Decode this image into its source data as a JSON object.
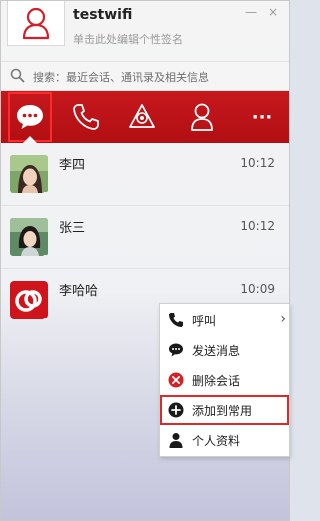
{
  "header": {
    "username": "testwifi",
    "signature": "单击此处编辑个性签名",
    "minimize_label": "—",
    "close_label": "×"
  },
  "search": {
    "placeholder": "搜索：最近会话、通讯录及相关信息"
  },
  "tabs": [
    {
      "icon": "chat-bubble-icon",
      "active": true
    },
    {
      "icon": "phone-icon",
      "active": false
    },
    {
      "icon": "group-chat-icon",
      "active": false
    },
    {
      "icon": "contact-person-icon",
      "active": false
    },
    {
      "icon": "more-icon",
      "label": "···",
      "active": false
    }
  ],
  "conversations": [
    {
      "name": "李四",
      "time": "10:12",
      "avatar": "female-avatar"
    },
    {
      "name": "张三",
      "time": "10:12",
      "avatar": "male-avatar"
    },
    {
      "name": "李哈哈",
      "time": "10:09",
      "avatar": "brand-logo-avatar"
    }
  ],
  "context_menu": {
    "items": [
      {
        "label": "呼叫",
        "icon": "phone-icon",
        "submenu": true
      },
      {
        "label": "发送消息",
        "icon": "message-icon"
      },
      {
        "label": "删除会话",
        "icon": "delete-icon"
      },
      {
        "label": "添加到常用",
        "icon": "add-icon",
        "highlighted": true
      },
      {
        "label": "个人资料",
        "icon": "profile-icon"
      }
    ],
    "submenu_arrow": "›"
  },
  "colors": {
    "accent": "#b80f14",
    "highlight_border": "#e12828"
  }
}
